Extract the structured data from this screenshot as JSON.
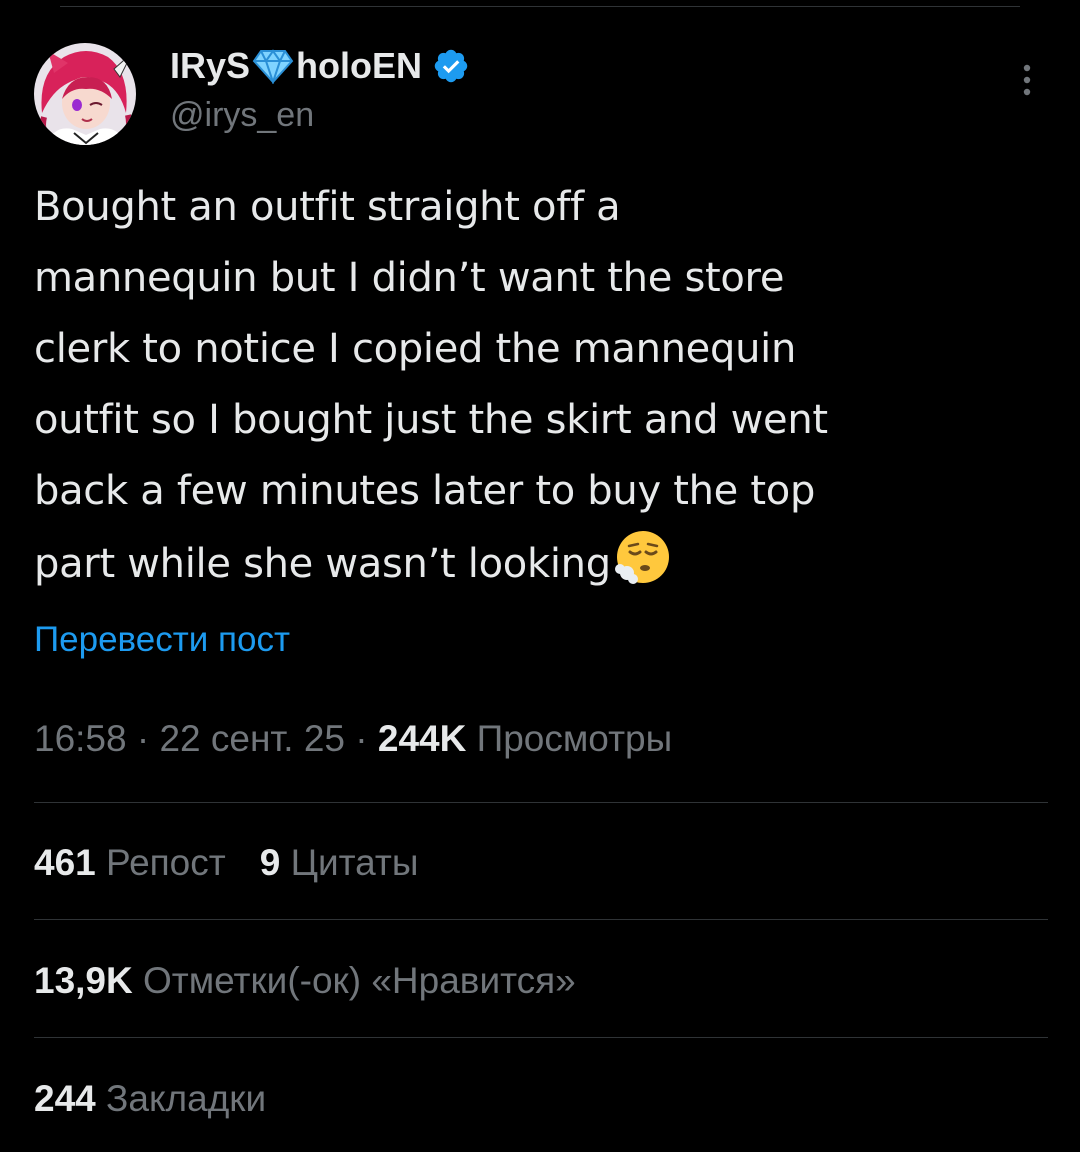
{
  "author": {
    "display_name_part1": "IRyS",
    "display_name_part2": "holoEN",
    "handle": "@irys_en",
    "verified": true,
    "accent_color": "#1d9bf0"
  },
  "tweet": {
    "lines": [
      "Bought an outfit straight off a",
      "mannequin but I didn’t want the store",
      "clerk to notice I copied the mannequin",
      "outfit so I bought just the skirt and went",
      "back a few minutes later to buy the top",
      "part while she wasn’t looking"
    ],
    "trailing_emoji": "face-exhaling-icon"
  },
  "translate_label": "Перевести пост",
  "meta": {
    "time": "16:58",
    "sep1": " · ",
    "date": "22 сент. 25",
    "sep2": " · ",
    "views_count": "244K",
    "views_label": " Просмотры"
  },
  "stats": {
    "reposts_count": "461",
    "reposts_label": " Репост",
    "quotes_count": "9",
    "quotes_label": " Цитаты",
    "likes_count": "13,9K",
    "likes_label": " Отметки(-ок) «Нравится»",
    "bookmarks_count": "244",
    "bookmarks_label": " Закладки"
  },
  "icons": {
    "gem": "gem-icon",
    "verified": "verified-badge-icon",
    "more": "more-vertical-icon"
  }
}
